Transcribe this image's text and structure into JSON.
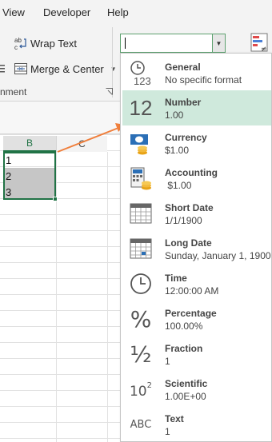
{
  "ribbon": {
    "tabs": [
      "View",
      "Developer",
      "Help"
    ],
    "wrap_text_label": "Wrap Text",
    "merge_center_label": "Merge & Center",
    "group_label": "nment"
  },
  "sheet": {
    "columns": [
      "B",
      "C"
    ],
    "cells": [
      "1",
      "2",
      "3"
    ]
  },
  "menu": {
    "items": [
      {
        "name": "General",
        "sample": "No specific format",
        "icon": "clock-123-icon"
      },
      {
        "name": "Number",
        "sample": "1.00",
        "icon": "number-12-icon",
        "selected": true
      },
      {
        "name": "Currency",
        "sample": "$1.00",
        "icon": "currency-icon"
      },
      {
        "name": "Accounting",
        "sample": " $1.00",
        "icon": "accounting-icon"
      },
      {
        "name": "Short Date",
        "sample": "1/1/1900",
        "icon": "short-date-calendar-icon"
      },
      {
        "name": "Long Date",
        "sample": "Sunday, January 1, 1900",
        "icon": "long-date-calendar-icon"
      },
      {
        "name": "Time",
        "sample": "12:00:00 AM",
        "icon": "clock-icon"
      },
      {
        "name": "Percentage",
        "sample": "100.00%",
        "icon": "percent-icon"
      },
      {
        "name": "Fraction",
        "sample": "1",
        "icon": "fraction-half-icon"
      },
      {
        "name": "Scientific",
        "sample": "1.00E+00",
        "icon": "scientific-10-squared-icon"
      },
      {
        "name": "Text",
        "sample": "1",
        "icon": "abc-text-icon"
      }
    ],
    "glyphs": {
      "number": "12",
      "percent": "%",
      "fraction": "½",
      "scientific_base": "10",
      "scientific_exp": "2",
      "text": "ABC",
      "general_digits": "123"
    }
  },
  "colors": {
    "accent_green": "#217346",
    "selected_item_bg": "#cfe9dc",
    "arrow": "#f07f3c"
  }
}
